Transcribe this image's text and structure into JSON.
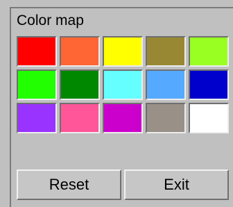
{
  "panel": {
    "title": "Color map"
  },
  "colors": [
    {
      "name": "red",
      "hex": "#ff0000"
    },
    {
      "name": "orange",
      "hex": "#ff6633"
    },
    {
      "name": "yellow",
      "hex": "#ffff00"
    },
    {
      "name": "olive",
      "hex": "#998833"
    },
    {
      "name": "lime",
      "hex": "#99ff22"
    },
    {
      "name": "green",
      "hex": "#22ff00"
    },
    {
      "name": "dark-green",
      "hex": "#008800"
    },
    {
      "name": "cyan",
      "hex": "#66ffff"
    },
    {
      "name": "sky-blue",
      "hex": "#55aaff"
    },
    {
      "name": "blue",
      "hex": "#0000cc"
    },
    {
      "name": "purple",
      "hex": "#9933ff"
    },
    {
      "name": "pink",
      "hex": "#ff5599"
    },
    {
      "name": "magenta",
      "hex": "#cc00cc"
    },
    {
      "name": "gray",
      "hex": "#999088"
    },
    {
      "name": "white",
      "hex": "#ffffff"
    }
  ],
  "buttons": {
    "reset_label": "Reset",
    "exit_label": "Exit"
  }
}
